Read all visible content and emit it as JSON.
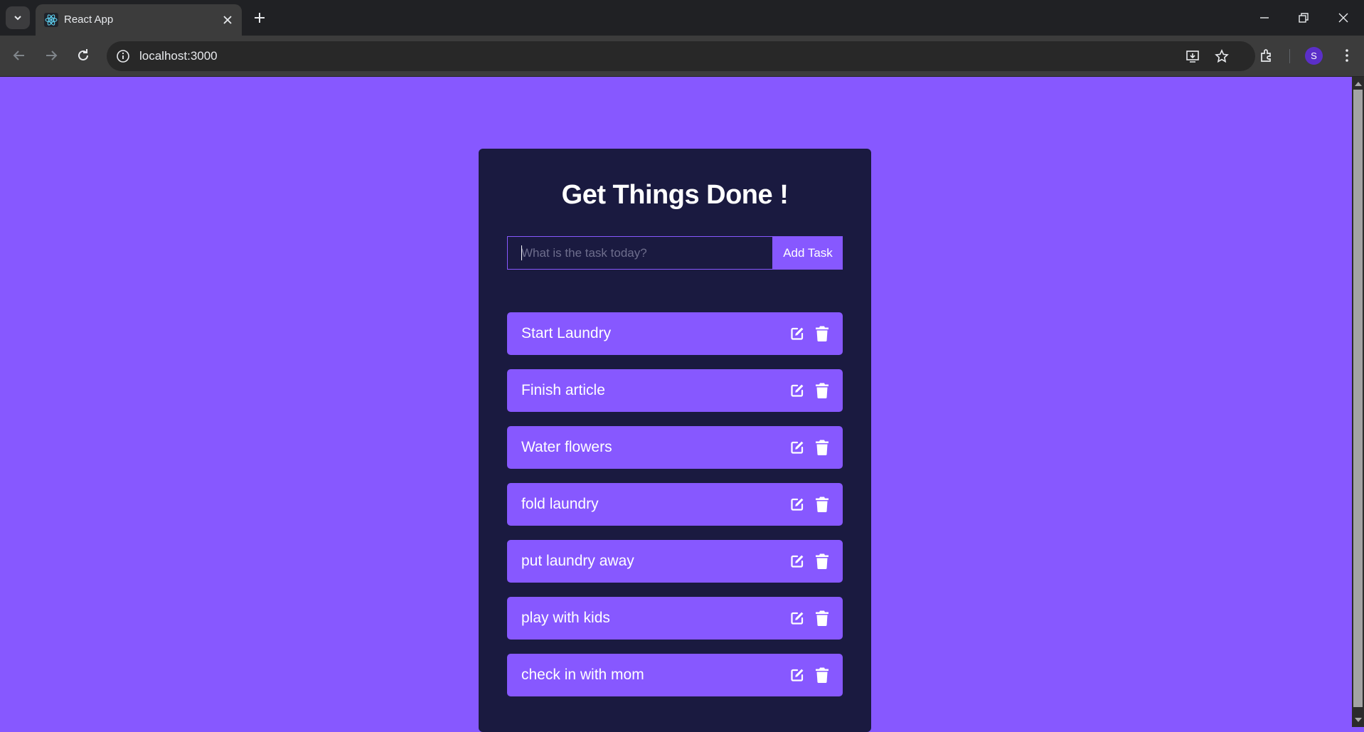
{
  "browser": {
    "tab": {
      "title": "React App",
      "icon": "react-icon"
    },
    "url": "localhost:3000",
    "profile_initial": "S"
  },
  "app": {
    "heading": "Get Things Done !",
    "input_placeholder": "What is the task today?",
    "input_value": "",
    "add_button_label": "Add Task",
    "todos": [
      {
        "task": "Start Laundry"
      },
      {
        "task": "Finish article"
      },
      {
        "task": "Water flowers"
      },
      {
        "task": "fold laundry"
      },
      {
        "task": "put laundry away"
      },
      {
        "task": "play with kids"
      },
      {
        "task": "check in with mom"
      }
    ],
    "colors": {
      "page_background": "#8758ff",
      "card_background": "#1a1a40",
      "todo_background": "#8758ff",
      "text": "#ffffff"
    }
  }
}
